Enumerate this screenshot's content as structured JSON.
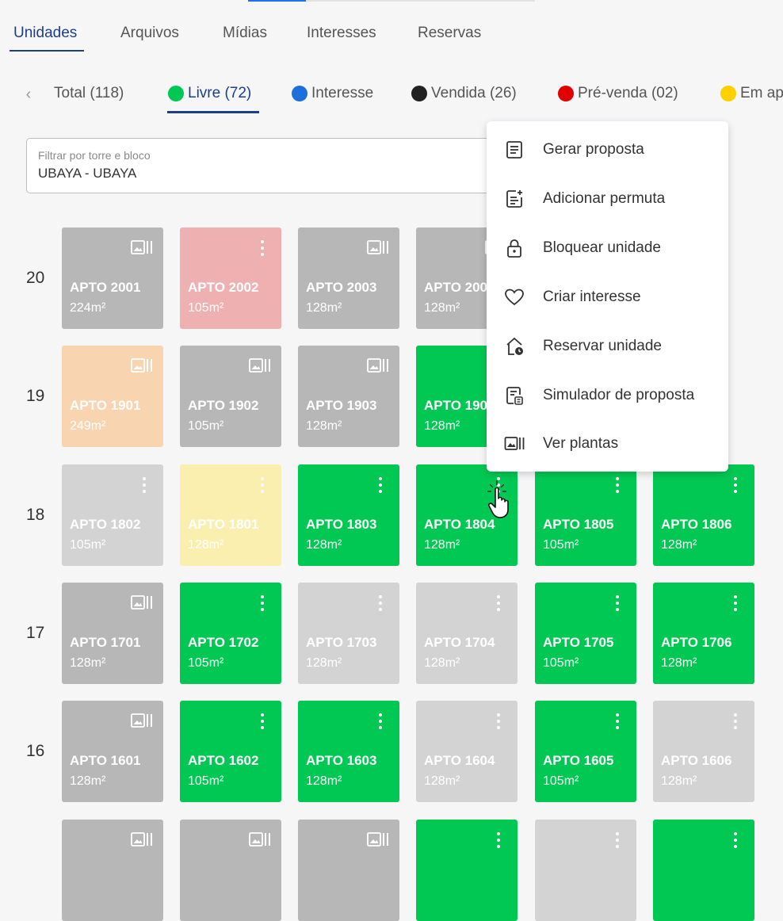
{
  "tabs": [
    {
      "label": "Unidades",
      "active": true
    },
    {
      "label": "Arquivos",
      "active": false
    },
    {
      "label": "Mídias",
      "active": false
    },
    {
      "label": "Interesses",
      "active": false
    },
    {
      "label": "Reservas",
      "active": false
    }
  ],
  "status_filters": [
    {
      "label": "Total (118)",
      "color": null,
      "active": false
    },
    {
      "label": "Livre (72)",
      "color": "#00c853",
      "active": true
    },
    {
      "label": "Interesse",
      "color": "#1e6fd9",
      "active": false
    },
    {
      "label": "Vendida (26)",
      "color": "#222222",
      "active": false
    },
    {
      "label": "Pré-venda (02)",
      "color": "#e00000",
      "active": false
    },
    {
      "label": "Em ap",
      "color": "#ffd000",
      "active": false
    }
  ],
  "tower_filter": {
    "label": "Filtrar por torre e bloco",
    "value": "UBAYA - UBAYA"
  },
  "colors": {
    "livre": "#00c853",
    "gray": "#b7b7b7",
    "light_gray": "#d3d3d3",
    "pink": "#eeb0b0",
    "peach": "#f8d5b0",
    "yellow": "#fbefb0",
    "accent": "#1c3f8a"
  },
  "floors": [
    {
      "floor": "20",
      "units": [
        {
          "name": "APTO 2001",
          "area": "224m²",
          "color": "#b7b7b7",
          "icon": "floor-plan-icon"
        },
        {
          "name": "APTO 2002",
          "area": "105m²",
          "color": "#eeb0b0",
          "icon": "more-vert-icon"
        },
        {
          "name": "APTO 2003",
          "area": "128m²",
          "color": "#b7b7b7",
          "icon": "floor-plan-icon"
        },
        {
          "name": "APTO 2004",
          "area": "128m²",
          "color": "#b7b7b7",
          "icon": "floor-plan-icon"
        }
      ]
    },
    {
      "floor": "19",
      "units": [
        {
          "name": "APTO 1901",
          "area": "249m²",
          "color": "#f8d5b0",
          "icon": "floor-plan-icon"
        },
        {
          "name": "APTO 1902",
          "area": "105m²",
          "color": "#b7b7b7",
          "icon": "floor-plan-icon"
        },
        {
          "name": "APTO 1903",
          "area": "128m²",
          "color": "#b7b7b7",
          "icon": "floor-plan-icon"
        },
        {
          "name": "APTO 1904",
          "area": "128m²",
          "color": "#00c853",
          "icon": "more-vert-icon"
        }
      ]
    },
    {
      "floor": "18",
      "units": [
        {
          "name": "APTO 1802",
          "area": "105m²",
          "color": "#d3d3d3",
          "icon": "more-vert-icon"
        },
        {
          "name": "APTO 1801",
          "area": "128m²",
          "color": "#fbefb0",
          "icon": "more-vert-icon"
        },
        {
          "name": "APTO 1803",
          "area": "128m²",
          "color": "#00c853",
          "icon": "more-vert-icon"
        },
        {
          "name": "APTO 1804",
          "area": "128m²",
          "color": "#00c853",
          "icon": "more-vert-icon"
        },
        {
          "name": "APTO 1805",
          "area": "105m²",
          "color": "#00c853",
          "icon": "more-vert-icon"
        },
        {
          "name": "APTO 1806",
          "area": "128m²",
          "color": "#00c853",
          "icon": "more-vert-icon"
        }
      ]
    },
    {
      "floor": "17",
      "units": [
        {
          "name": "APTO 1701",
          "area": "128m²",
          "color": "#b7b7b7",
          "icon": "floor-plan-icon"
        },
        {
          "name": "APTO 1702",
          "area": "105m²",
          "color": "#00c853",
          "icon": "more-vert-icon"
        },
        {
          "name": "APTO 1703",
          "area": "128m²",
          "color": "#d3d3d3",
          "icon": "more-vert-icon"
        },
        {
          "name": "APTO 1704",
          "area": "128m²",
          "color": "#d3d3d3",
          "icon": "more-vert-icon"
        },
        {
          "name": "APTO 1705",
          "area": "105m²",
          "color": "#00c853",
          "icon": "more-vert-icon"
        },
        {
          "name": "APTO 1706",
          "area": "128m²",
          "color": "#00c853",
          "icon": "more-vert-icon"
        }
      ]
    },
    {
      "floor": "16",
      "units": [
        {
          "name": "APTO 1601",
          "area": "128m²",
          "color": "#b7b7b7",
          "icon": "floor-plan-icon"
        },
        {
          "name": "APTO 1602",
          "area": "105m²",
          "color": "#00c853",
          "icon": "more-vert-icon"
        },
        {
          "name": "APTO 1603",
          "area": "128m²",
          "color": "#00c853",
          "icon": "more-vert-icon"
        },
        {
          "name": "APTO 1604",
          "area": "128m²",
          "color": "#d3d3d3",
          "icon": "more-vert-icon"
        },
        {
          "name": "APTO 1605",
          "area": "105m²",
          "color": "#00c853",
          "icon": "more-vert-icon"
        },
        {
          "name": "APTO 1606",
          "area": "128m²",
          "color": "#d3d3d3",
          "icon": "more-vert-icon"
        }
      ]
    },
    {
      "floor": "",
      "units": [
        {
          "name": "",
          "area": "",
          "color": "#b7b7b7",
          "icon": "floor-plan-icon"
        },
        {
          "name": "",
          "area": "",
          "color": "#b7b7b7",
          "icon": "floor-plan-icon"
        },
        {
          "name": "",
          "area": "",
          "color": "#b7b7b7",
          "icon": "floor-plan-icon"
        },
        {
          "name": "",
          "area": "",
          "color": "#00c853",
          "icon": "more-vert-icon"
        },
        {
          "name": "",
          "area": "",
          "color": "#d3d3d3",
          "icon": "more-vert-icon"
        },
        {
          "name": "",
          "area": "",
          "color": "#00c853",
          "icon": "more-vert-icon"
        }
      ]
    }
  ],
  "unit_menu": [
    {
      "label": "Gerar proposta",
      "icon": "document-icon"
    },
    {
      "label": "Adicionar permuta",
      "icon": "document-add-icon"
    },
    {
      "label": "Bloquear unidade",
      "icon": "lock-icon"
    },
    {
      "label": "Criar interesse",
      "icon": "heart-icon"
    },
    {
      "label": "Reservar unidade",
      "icon": "home-clock-icon"
    },
    {
      "label": "Simulador de proposta",
      "icon": "document-calculator-icon"
    },
    {
      "label": "Ver plantas",
      "icon": "floor-plan-icon"
    }
  ]
}
